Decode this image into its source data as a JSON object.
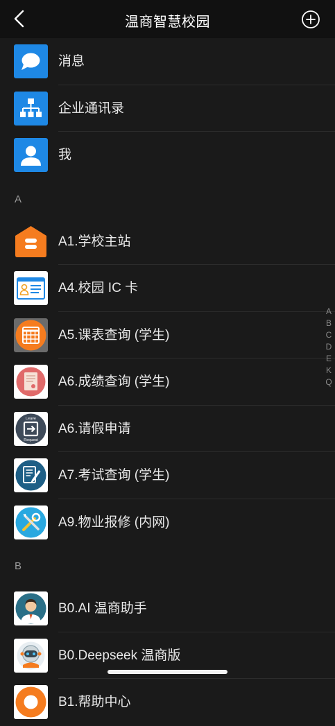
{
  "header": {
    "title": "温商智慧校园"
  },
  "top_items": [
    {
      "label": "消息",
      "icon": "chat-bubble-icon"
    },
    {
      "label": "企业通讯录",
      "icon": "org-chart-icon"
    },
    {
      "label": "我",
      "icon": "person-icon"
    }
  ],
  "sections": [
    {
      "letter": "A",
      "items": [
        {
          "label": "A1.学校主站",
          "icon": "school-home-icon"
        },
        {
          "label": "A4.校园 IC 卡",
          "icon": "id-card-icon"
        },
        {
          "label": "A5.课表查询 (学生)",
          "icon": "calendar-icon"
        },
        {
          "label": "A6.成绩查询 (学生)",
          "icon": "report-card-icon"
        },
        {
          "label": "A6.请假申请",
          "icon": "leave-request-icon",
          "badge_top": "Leave",
          "badge_bottom": "Request"
        },
        {
          "label": "A7.考试查询 (学生)",
          "icon": "exam-edit-icon"
        },
        {
          "label": "A9.物业报修 (内网)",
          "icon": "repair-tools-icon"
        }
      ]
    },
    {
      "letter": "B",
      "items": [
        {
          "label": "B0.AI 温商助手",
          "icon": "ai-assistant-avatar-icon"
        },
        {
          "label": "B0.Deepseek 温商版",
          "icon": "deepseek-robot-icon"
        },
        {
          "label": "B1.帮助中心",
          "icon": "help-center-icon"
        }
      ]
    }
  ],
  "alphabet_index": [
    "A",
    "B",
    "C",
    "D",
    "E",
    "K",
    "Q"
  ],
  "colors": {
    "background": "#1a1a1a",
    "nav_background": "#111111",
    "accent_blue": "#1e88e5",
    "orange": "#f57c1f"
  }
}
